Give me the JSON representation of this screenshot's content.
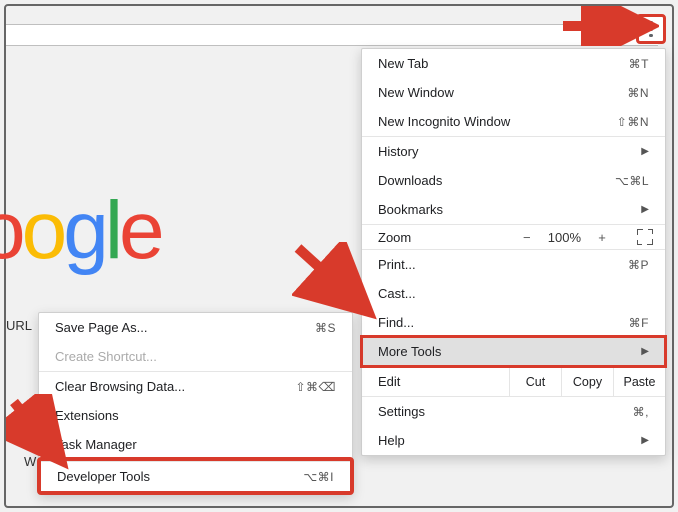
{
  "logo": {
    "part1": "o",
    "part2": "o",
    "part3": "g",
    "part4": "l",
    "part5": "e"
  },
  "labels": {
    "url": "URL",
    "violin": "W"
  },
  "main_menu": {
    "new_tab": {
      "label": "New Tab",
      "shortcut": "⌘T"
    },
    "new_window": {
      "label": "New Window",
      "shortcut": "⌘N"
    },
    "new_incognito": {
      "label": "New Incognito Window",
      "shortcut": "⇧⌘N"
    },
    "history": {
      "label": "History"
    },
    "downloads": {
      "label": "Downloads",
      "shortcut": "⌥⌘L"
    },
    "bookmarks": {
      "label": "Bookmarks"
    },
    "zoom": {
      "label": "Zoom",
      "value": "100%"
    },
    "print": {
      "label": "Print...",
      "shortcut": "⌘P"
    },
    "cast": {
      "label": "Cast..."
    },
    "find": {
      "label": "Find...",
      "shortcut": "⌘F"
    },
    "more_tools": {
      "label": "More Tools"
    },
    "edit": {
      "label": "Edit",
      "cut": "Cut",
      "copy": "Copy",
      "paste": "Paste"
    },
    "settings": {
      "label": "Settings",
      "shortcut": "⌘,"
    },
    "help": {
      "label": "Help"
    }
  },
  "sub_menu": {
    "save_page": {
      "label": "Save Page As...",
      "shortcut": "⌘S"
    },
    "create_shortcut": {
      "label": "Create Shortcut..."
    },
    "clear_data": {
      "label": "Clear Browsing Data...",
      "shortcut": "⇧⌘⌫"
    },
    "extensions": {
      "label": "Extensions"
    },
    "task_manager": {
      "label": "Task Manager"
    },
    "dev_tools": {
      "label": "Developer Tools",
      "shortcut": "⌥⌘I"
    }
  }
}
